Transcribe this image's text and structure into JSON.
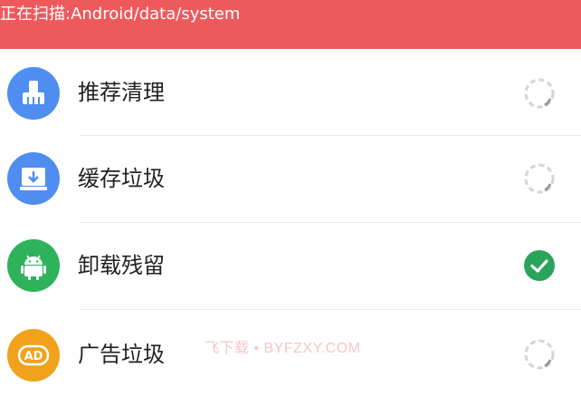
{
  "header": {
    "scan_text": "正在扫描:Android/data/system",
    "color": "#ee5a5c"
  },
  "items": [
    {
      "label": "推荐清理",
      "icon": "broom-icon",
      "icon_color": "#4f8ef0",
      "status": "loading"
    },
    {
      "label": "缓存垃圾",
      "icon": "download-icon",
      "icon_color": "#4f8ef0",
      "status": "loading"
    },
    {
      "label": "卸载残留",
      "icon": "android-icon",
      "icon_color": "#2fb25c",
      "status": "done"
    },
    {
      "label": "广告垃圾",
      "icon": "ad-icon",
      "icon_color": "#f0a21c",
      "status": "loading",
      "icon_text": "AD"
    }
  ],
  "watermark": "飞下载 • BYFZXY.COM",
  "colors": {
    "check": "#2aa35b",
    "spinner": "#d4d4d4"
  }
}
